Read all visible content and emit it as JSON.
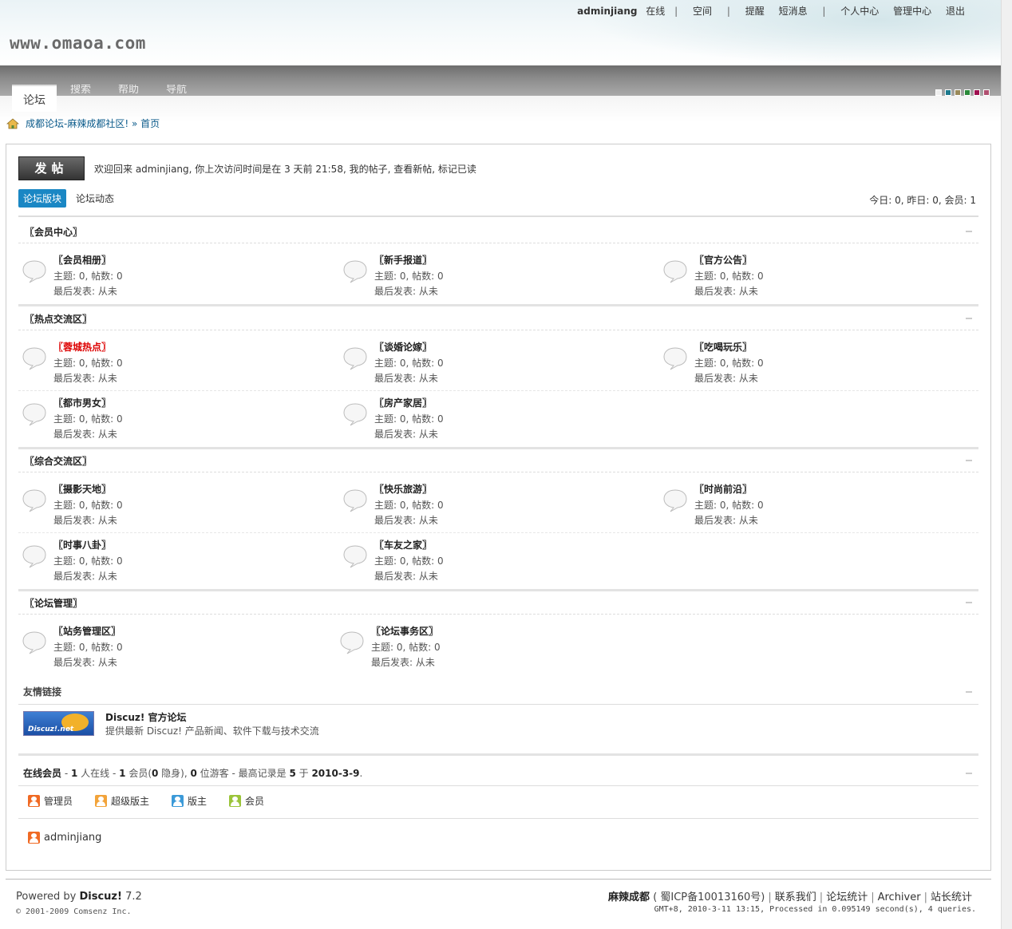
{
  "header": {
    "logo": "www.omaoa.com",
    "username": "adminjiang",
    "status": "在线",
    "menu": [
      "空间",
      "提醒",
      "短消息",
      "个人中心",
      "管理中心",
      "退出"
    ]
  },
  "nav": {
    "tabs": [
      "论坛",
      "搜索",
      "帮助",
      "导航"
    ],
    "style_colors": [
      "#eeeeee",
      "#1d7a8e",
      "#9a8a5a",
      "#2a8a3a",
      "#a01050",
      "#b05070"
    ]
  },
  "breadcrumb": {
    "site": "成都论坛-麻辣成都社区!",
    "sep": "»",
    "current": "首页"
  },
  "main": {
    "post_button": "发帖",
    "welcome": "欢迎回来 adminjiang, 你上次访问时间是在 3 天前 21:58, 我的帖子, 查看新帖, 标记已读",
    "tab_forums": "论坛版块",
    "tab_activity": "论坛动态",
    "stats": "今日: 0, 昨日: 0, 会员: 1"
  },
  "sections": [
    {
      "title": "〖会员中心〗",
      "forums": [
        {
          "name": "〖会员相册〗",
          "stats": "主题: 0, 帖数: 0",
          "last": "最后发表: 从未"
        },
        {
          "name": "〖新手报道〗",
          "stats": "主题: 0, 帖数: 0",
          "last": "最后发表: 从未"
        },
        {
          "name": "〖官方公告〗",
          "stats": "主题: 0, 帖数: 0",
          "last": "最后发表: 从未"
        }
      ]
    },
    {
      "title": "〖热点交流区〗",
      "forums": [
        {
          "name": "〖蓉城热点〗",
          "stats": "主题: 0, 帖数: 0",
          "last": "最后发表: 从未"
        },
        {
          "name": "〖谈婚论嫁〗",
          "stats": "主题: 0, 帖数: 0",
          "last": "最后发表: 从未"
        },
        {
          "name": "〖吃喝玩乐〗",
          "stats": "主题: 0, 帖数: 0",
          "last": "最后发表: 从未"
        },
        {
          "name": "〖都市男女〗",
          "stats": "主题: 0, 帖数: 0",
          "last": "最后发表: 从未"
        },
        {
          "name": "〖房产家居〗",
          "stats": "主题: 0, 帖数: 0",
          "last": "最后发表: 从未"
        }
      ]
    },
    {
      "title": "〖综合交流区〗",
      "forums": [
        {
          "name": "〖摄影天地〗",
          "stats": "主题: 0, 帖数: 0",
          "last": "最后发表: 从未"
        },
        {
          "name": "〖快乐旅游〗",
          "stats": "主题: 0, 帖数: 0",
          "last": "最后发表: 从未"
        },
        {
          "name": "〖时尚前沿〗",
          "stats": "主题: 0, 帖数: 0",
          "last": "最后发表: 从未"
        },
        {
          "name": "〖时事八卦〗",
          "stats": "主题: 0, 帖数: 0",
          "last": "最后发表: 从未"
        },
        {
          "name": "〖车友之家〗",
          "stats": "主题: 0, 帖数: 0",
          "last": "最后发表: 从未"
        }
      ]
    },
    {
      "title": "〖论坛管理〗",
      "forums": [
        {
          "name": "〖站务管理区〗",
          "stats": "主题: 0, 帖数: 0",
          "last": "最后发表: 从未"
        },
        {
          "name": "〖论坛事务区〗",
          "stats": "主题: 0, 帖数: 0",
          "last": "最后发表: 从未"
        }
      ]
    }
  ],
  "links": {
    "title": "友情链接",
    "logo_text": "Discuz!.net",
    "name": "Discuz! 官方论坛",
    "desc": "提供最新 Discuz! 产品新闻、软件下载与技术交流"
  },
  "online": {
    "title": "在线会员",
    "p1": "- ",
    "total": "1",
    "p2": " 人在线 - ",
    "members": "1",
    "p3": " 会员(",
    "hidden": "0",
    "p4": " 隐身), ",
    "guests": "0",
    "p5": " 位游客 - 最高记录是 ",
    "record": "5",
    "p6": " 于 ",
    "record_date": "2010-3-9",
    "p7": ".",
    "legend": [
      "管理员",
      "超级版主",
      "版主",
      "会员"
    ],
    "users": [
      "adminjiang"
    ]
  },
  "footer": {
    "powered_prefix": "Powered by ",
    "powered_name": "Discuz!",
    "version": " 7.2",
    "copyright": "© 2001-2009 Comsenz Inc.",
    "site_name": "麻辣成都",
    "icp": "( 蜀ICP备10013160号)",
    "links": [
      "联系我们",
      "论坛统计",
      "Archiver",
      "站长统计"
    ],
    "gmt": "GMT+8, 2010-3-11 13:15, Processed in 0.095149 second(s), 4 queries."
  }
}
